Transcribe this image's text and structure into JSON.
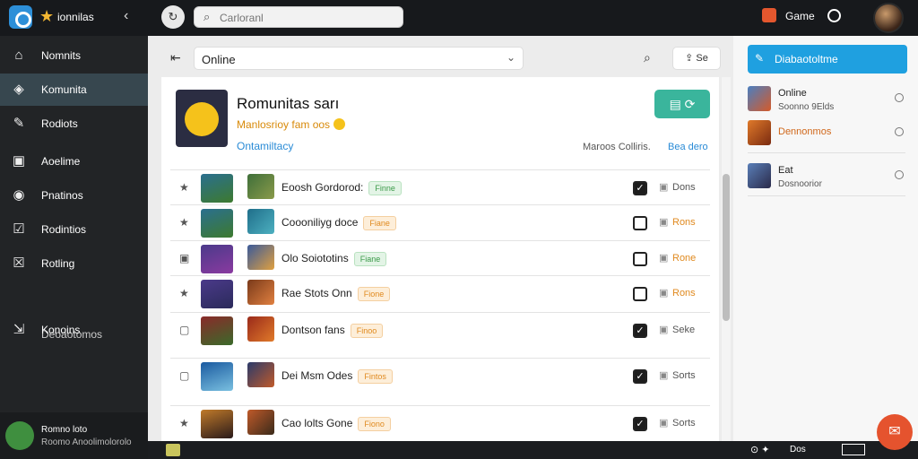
{
  "header": {
    "app_title": "ionnilas",
    "search_placeholder": "Carloranl",
    "game_label": "Game"
  },
  "sidebar": {
    "items": [
      {
        "label": "Nomnits",
        "icon": "home-icon"
      },
      {
        "label": "Komunita",
        "icon": "community-icon"
      },
      {
        "label": "Rodiots",
        "icon": "tools-icon"
      },
      {
        "label": "Aoelime",
        "icon": "store-icon"
      },
      {
        "label": "Pnatinos",
        "icon": "settings-icon"
      },
      {
        "label": "Rodintios",
        "icon": "shield-icon"
      },
      {
        "label": "Rotling",
        "icon": "close-box-icon"
      },
      {
        "label": "Konoins",
        "icon": "export-icon"
      }
    ],
    "sub_label": "Deoaotomos",
    "footer": {
      "name": "Romno loto",
      "sub": "Roomo Anoolimolorolo"
    }
  },
  "toolbar": {
    "filter_value": "Online",
    "button_label": "Se"
  },
  "panel": {
    "title": "Romunitas sarı",
    "subtitle": "Manlosrioy fam oos",
    "status": "Ontamiltacy",
    "meta": "Maroos Colliris.",
    "meta_link": "Bea dero"
  },
  "rows": [
    {
      "name": "Eoosh Gordorod:",
      "tag": "Finne",
      "tag_color": "green",
      "checked": true,
      "action": "Dons",
      "action_color": "grey"
    },
    {
      "name": "Coooniliyg doce",
      "tag": "Fiane",
      "tag_color": "orange",
      "checked": false,
      "action": "Rons",
      "action_color": "orange"
    },
    {
      "name": "Olo Soiototins",
      "tag": "Fiane",
      "tag_color": "green",
      "checked": false,
      "action": "Rone",
      "action_color": "orange"
    },
    {
      "name": "Rae Stots Onn",
      "tag": "Fione",
      "tag_color": "orange",
      "checked": false,
      "action": "Rons",
      "action_color": "orange"
    },
    {
      "name": "Dontson fans",
      "tag": "Finoo",
      "tag_color": "orange",
      "checked": true,
      "action": "Seke",
      "action_color": "grey"
    },
    {
      "name": "Dei Msm Odes",
      "tag": "Fintos",
      "tag_color": "orange",
      "checked": true,
      "action": "Sorts",
      "action_color": "grey"
    },
    {
      "name": "Cao lolts Gone",
      "tag": "Fiono",
      "tag_color": "orange",
      "checked": true,
      "action": "Sorts",
      "action_color": "grey"
    }
  ],
  "right_panel": {
    "button_label": "Diabaotoltme",
    "items": [
      {
        "title": "Online",
        "sub": "Soonno 9Elds"
      },
      {
        "title": "Dennonmos",
        "sub": ""
      },
      {
        "title": "Eat",
        "sub": "Dosnoorior"
      }
    ]
  },
  "bottom_bar": {
    "label": "Dos"
  },
  "colors": {
    "accent": "#1fa0e0",
    "play": "#3ab59c",
    "warning": "#e08a20",
    "sidebar": "#222426"
  }
}
